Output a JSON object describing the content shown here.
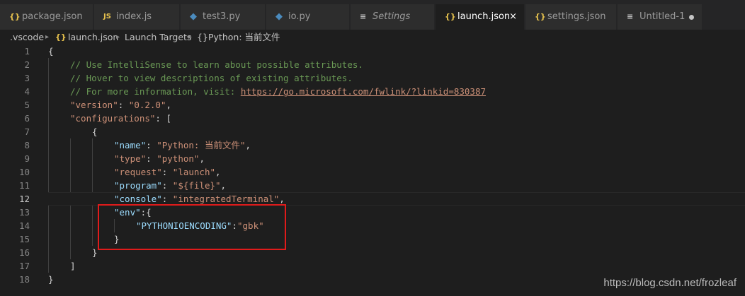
{
  "tabs": [
    {
      "icon": "{}",
      "label": "package.json"
    },
    {
      "icon": "JS",
      "label": "index.js"
    },
    {
      "icon": "◆",
      "label": "test3.py"
    },
    {
      "icon": "◆",
      "label": "io.py"
    },
    {
      "icon": "≡",
      "label": "Settings"
    },
    {
      "icon": "{}",
      "label": "launch.json",
      "close": "×"
    },
    {
      "icon": "{}",
      "label": "settings.json"
    },
    {
      "icon": "≡",
      "label": "Untitled-1"
    }
  ],
  "breadcrumb": {
    "folder": ".vscode",
    "sep": "▸",
    "file_icon": "{}",
    "file": "launch.json",
    "section": "Launch Targets",
    "item_icon": "{}",
    "item": "Python: 当前文件"
  },
  "editor": {
    "line_numbers": [
      "1",
      "2",
      "3",
      "4",
      "5",
      "6",
      "7",
      "8",
      "9",
      "10",
      "11",
      "12",
      "13",
      "14",
      "15",
      "16",
      "17",
      "18"
    ],
    "current_line": "12",
    "text": {
      "open_brace": "{",
      "comment1": "// Use IntelliSense to learn about possible attributes.",
      "comment2": "// Hover to view descriptions of existing attributes.",
      "comment3_prefix": "// For more information, visit: ",
      "comment3_link": "https://go.microsoft.com/fwlink/?linkid=830387",
      "version_key": "\"version\"",
      "version_value": "\"0.2.0\"",
      "configurations_key": "\"configurations\"",
      "open_bracket": "[",
      "name_key": "\"name\"",
      "name_value": "\"Python: 当前文件\"",
      "type_key": "\"type\"",
      "type_value": "\"python\"",
      "request_key": "\"request\"",
      "request_value": "\"launch\"",
      "program_key": "\"program\"",
      "program_value": "\"${file}\"",
      "console_key": "\"console\"",
      "console_value": "\"integratedTerminal\"",
      "env_key": "\"env\"",
      "encoding_key": "\"PYTHONIOENCODING\"",
      "encoding_value": "\"gbk\"",
      "close_brace": "}",
      "close_bracket": "]",
      "colon": ": ",
      "colon_tight": ":",
      "comma": ","
    }
  },
  "watermark": "https://blog.csdn.net/frozleaf",
  "colors": {
    "background": "#1e1e1e",
    "comment": "#6a9955",
    "property_key": "#9cdcfe",
    "string": "#ce9178",
    "highlight_box": "#e01b1b"
  }
}
